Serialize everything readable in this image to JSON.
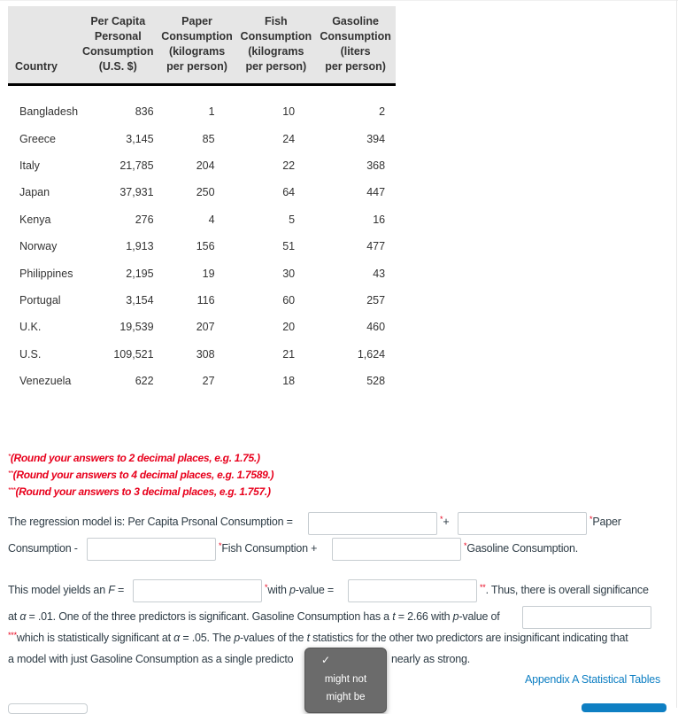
{
  "table": {
    "headers": [
      [
        "Country"
      ],
      [
        "Per Capita",
        "Personal",
        "Consumption",
        "(U.S. $)"
      ],
      [
        "Paper",
        "Consumption",
        "(kilograms",
        "per person)"
      ],
      [
        "Fish",
        "Consumption",
        "(kilograms",
        "per person)"
      ],
      [
        "Gasoline",
        "Consumption",
        "(liters",
        "per person)"
      ]
    ],
    "rows": [
      [
        "Bangladesh",
        "836",
        "1",
        "10",
        "2"
      ],
      [
        "Greece",
        "3,145",
        "85",
        "24",
        "394"
      ],
      [
        "Italy",
        "21,785",
        "204",
        "22",
        "368"
      ],
      [
        "Japan",
        "37,931",
        "250",
        "64",
        "447"
      ],
      [
        "Kenya",
        "276",
        "4",
        "5",
        "16"
      ],
      [
        "Norway",
        "1,913",
        "156",
        "51",
        "477"
      ],
      [
        "Philippines",
        "2,195",
        "19",
        "30",
        "43"
      ],
      [
        "Portugal",
        "3,154",
        "116",
        "60",
        "257"
      ],
      [
        "U.K.",
        "19,539",
        "207",
        "20",
        "460"
      ],
      [
        "U.S.",
        "109,521",
        "308",
        "21",
        "1,624"
      ],
      [
        "Venezuela",
        "622",
        "27",
        "18",
        "528"
      ]
    ]
  },
  "notes": {
    "n1_mark": "*",
    "n1": "(Round your answers to 2 decimal places, e.g. 1.75.)",
    "n2_mark": "**",
    "n2": "(Round your answers to 4 decimal places, e.g. 1.7589.)",
    "n3_mark": "***",
    "n3": "(Round your answers to 3 decimal places, e.g. 1.757.)"
  },
  "regression": {
    "t1": "The regression model is: Per Capita Prsonal Consumption =",
    "plus1": "+",
    "paper": "Paper",
    "consumption_minus": "Consumption -",
    "fish": "Fish Consumption +",
    "gasoline": "Gasoline Consumption.",
    "intercept_value": "",
    "paper_coef_value": "",
    "fish_coef_value": "",
    "gas_coef_value": ""
  },
  "model": {
    "yields": "This model yields an",
    "F": "F",
    "eq": " =",
    "with": "with",
    "p": "p",
    "pvalue_eq": "-value =",
    "thus": ". Thus, there is overall significance",
    "line2_a": "at",
    "alpha": "α",
    "line2_b": "= .01. One of the three predictors is significant. Gasoline Consumption has a",
    "t": "t",
    "line2_c": "= 2.66 with",
    "line2_d": "-value of",
    "line3_a": "which is statistically significant at",
    "line3_b": "= .05. The",
    "line3_c": "-values of the",
    "line3_d": "statistics for the other two predictors are insignificant indicating that",
    "line4_a": "a model with just Gasoline Consumption as a single predicto",
    "line4_b": "nearly as strong.",
    "f_value": "",
    "p_value": "",
    "gas_p_value": ""
  },
  "dropdown": {
    "selected": "",
    "check": "✓",
    "options": [
      "might not",
      "might be"
    ]
  },
  "link": "Appendix A Statistical Tables"
}
